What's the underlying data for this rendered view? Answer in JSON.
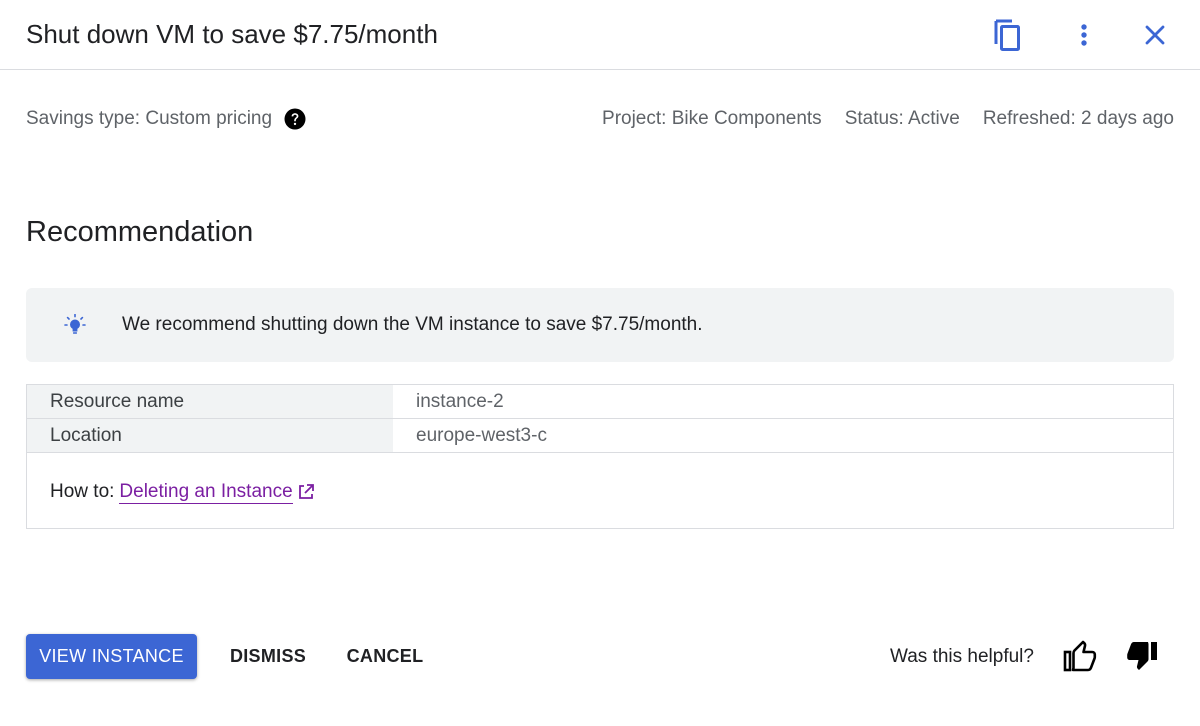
{
  "header": {
    "title": "Shut down VM to save $7.75/month",
    "icons": [
      "copy-icon",
      "more-vert-icon",
      "close-icon"
    ],
    "accent_color": "#3c66d4"
  },
  "meta": {
    "savings_type": "Savings type: Custom pricing",
    "project": "Project: Bike Components",
    "status": "Status: Active",
    "refreshed": "Refreshed: 2 days ago"
  },
  "recommendation": {
    "heading": "Recommendation",
    "callout_text": "We recommend shutting down the VM instance to save $7.75/month.",
    "callout_icon": "lightbulb-icon"
  },
  "details": {
    "rows": [
      {
        "label": "Resource name",
        "value": "instance-2"
      },
      {
        "label": "Location",
        "value": "europe-west3-c"
      }
    ],
    "howto_label": "How to:",
    "howto_link": "Deleting an Instance"
  },
  "actions": {
    "primary": "VIEW INSTANCE",
    "dismiss": "DISMISS",
    "cancel": "CANCEL"
  },
  "feedback": {
    "question": "Was this helpful?",
    "icons": [
      "thumb-up-icon",
      "thumb-down-icon"
    ]
  }
}
